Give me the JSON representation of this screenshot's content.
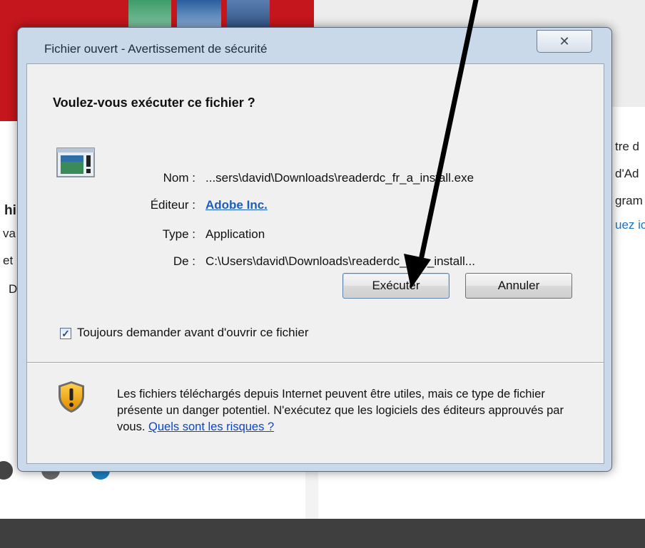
{
  "background": {
    "text_fragments": [
      {
        "id": "bg-right-1",
        "text": "tre d",
        "style": "normal"
      },
      {
        "id": "bg-right-2",
        "text": "d'Ad",
        "style": "normal"
      },
      {
        "id": "bg-right-3",
        "text": "gram",
        "style": "normal"
      },
      {
        "id": "bg-right-4",
        "text": "uez ic",
        "style": "link"
      },
      {
        "id": "bg-left-1",
        "text": "hi",
        "style": "bold"
      },
      {
        "id": "bg-left-2",
        "text": "va",
        "style": "normal"
      },
      {
        "id": "bg-left-3",
        "text": "et",
        "style": "normal"
      },
      {
        "id": "bg-left-4",
        "text": "D",
        "style": "normal"
      }
    ]
  },
  "dialog": {
    "title": "Fichier ouvert - Avertissement de sécurité",
    "close_glyph": "✕",
    "question": "Voulez-vous exécuter ce fichier ?",
    "fields": {
      "name_label": "Nom :",
      "name_value": "...sers\\david\\Downloads\\readerdc_fr_a_install.exe",
      "publisher_label": "Éditeur :",
      "publisher_value": "Adobe Inc.",
      "type_label": "Type :",
      "type_value": "Application",
      "from_label": "De :",
      "from_value": "C:\\Users\\david\\Downloads\\readerdc_fr_a_install..."
    },
    "buttons": {
      "run": "Exécuter",
      "cancel": "Annuler"
    },
    "checkbox": {
      "label": "Toujours demander avant d'ouvrir ce fichier",
      "checked": true,
      "check_glyph": "✓"
    },
    "warning": {
      "text": "Les fichiers téléchargés depuis Internet peuvent être utiles, mais ce type de fichier présente un danger potentiel. N'exécutez que les logiciels des éditeurs approuvés par vous.",
      "link": "Quels sont les risques ?"
    }
  },
  "colors": {
    "dialog_frame": "#c9d9ea",
    "client_bg": "#f0f0f0",
    "link": "#0b46c8",
    "publisher_link": "#1c5ebd",
    "annotation_arrow": "#000000"
  },
  "icons": {
    "file": "application-file-icon",
    "shield": "security-shield-warning-icon",
    "annotation": "arrow-pointing-to-run-button"
  }
}
